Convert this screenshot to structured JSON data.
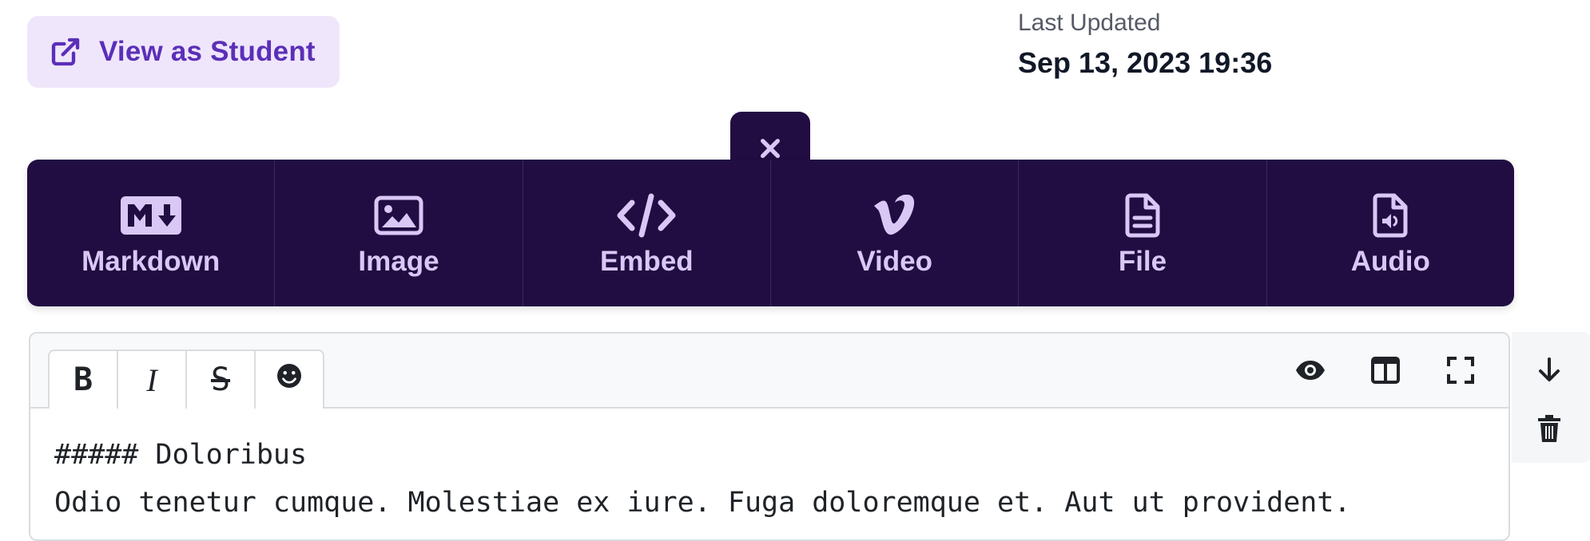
{
  "view_as_student": {
    "label": "View as Student",
    "icon": "external-link-icon"
  },
  "last_updated": {
    "label": "Last Updated",
    "value": "Sep 13, 2023 19:36"
  },
  "block_palette": {
    "close_icon": "close-icon",
    "items": [
      {
        "label": "Markdown",
        "icon": "markdown-icon"
      },
      {
        "label": "Image",
        "icon": "image-icon"
      },
      {
        "label": "Embed",
        "icon": "code-icon"
      },
      {
        "label": "Video",
        "icon": "vimeo-icon"
      },
      {
        "label": "File",
        "icon": "file-icon"
      },
      {
        "label": "Audio",
        "icon": "audio-file-icon"
      }
    ]
  },
  "editor": {
    "format_buttons": [
      {
        "label": "B",
        "name": "bold"
      },
      {
        "label": "I",
        "name": "italic"
      },
      {
        "label": "S",
        "name": "strikethrough"
      },
      {
        "label": "",
        "name": "emoji"
      }
    ],
    "right_tools": [
      "preview-icon",
      "side-by-side-icon",
      "fullscreen-icon"
    ],
    "content_lines": [
      "##### Doloribus",
      "Odio tenetur cumque. Molestiae ex iure. Fuga doloremque et. Aut ut provident."
    ]
  },
  "side_actions": [
    "move-down-icon",
    "delete-icon"
  ],
  "colors": {
    "palette_bg": "#210d42",
    "palette_text": "#d9c8f5",
    "accent": "#5b2fb8",
    "accent_bg": "#efe6fb"
  }
}
